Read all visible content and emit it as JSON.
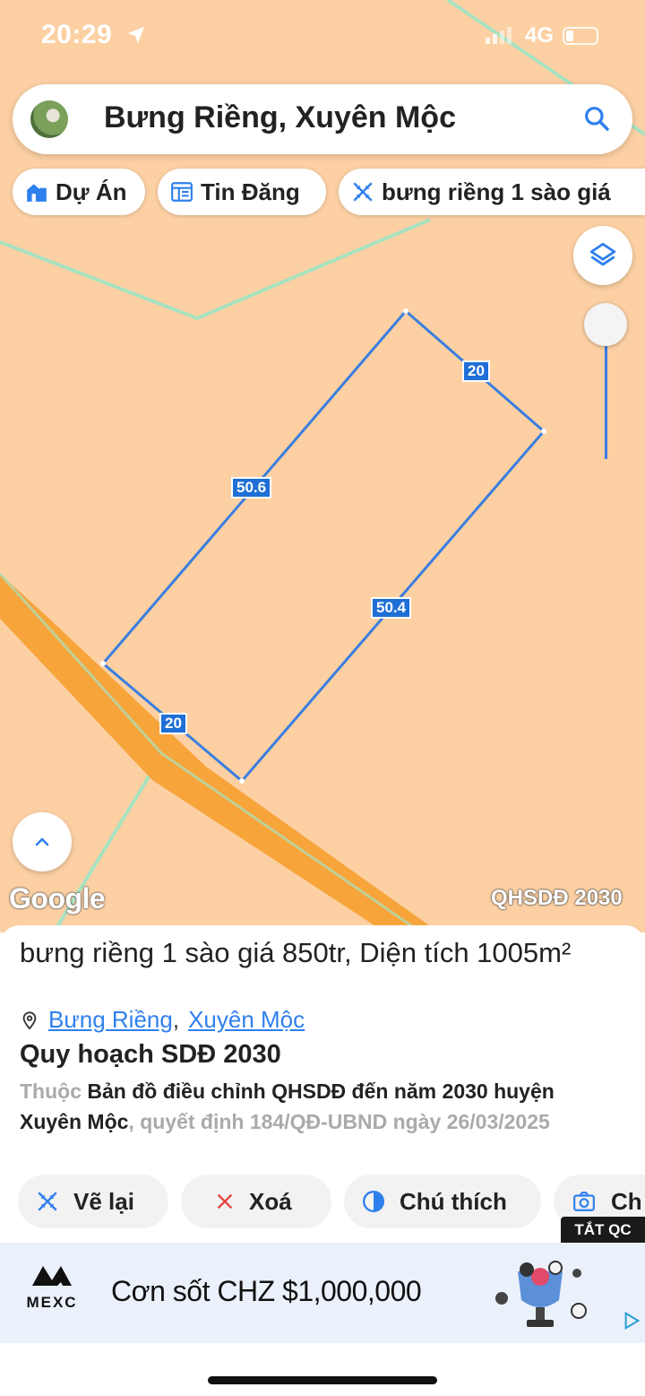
{
  "status_bar": {
    "time": "20:29",
    "network": "4G"
  },
  "search": {
    "query": "Bưng Riềng, Xuyên Mộc"
  },
  "chips": [
    {
      "label": "Dự Án",
      "icon": "building-icon"
    },
    {
      "label": "Tin Đăng",
      "icon": "news-icon"
    },
    {
      "label": "bưng riềng 1 sào giá",
      "icon": "ruler-icon"
    }
  ],
  "map": {
    "dimensions": [
      "20",
      "50.6",
      "50.4",
      "20"
    ],
    "google_label": "Google",
    "layer_label": "QHSDĐ 2030"
  },
  "listing": {
    "title": "bưng riềng 1 sào giá 850tr, Diện tích 1005m²",
    "location": {
      "commune": "Bưng Riềng",
      "separator": ",",
      "district": "Xuyên Mộc"
    },
    "plan_title": "Quy hoạch SDĐ 2030",
    "plan_desc": {
      "prefix": "Thuộc ",
      "map_name": "Bản đồ điều chỉnh QHSDĐ đến năm 2030 huyện Xuyên Mộc",
      "suffix": ", quyết định 184/QĐ-UBND ngày 26/03/2025"
    }
  },
  "actions": [
    {
      "label": "Vẽ lại",
      "icon": "ruler-icon"
    },
    {
      "label": "Xoá",
      "icon": "close-icon"
    },
    {
      "label": "Chú thích",
      "icon": "contrast-icon"
    },
    {
      "label": "Ch",
      "icon": "camera-icon"
    }
  ],
  "ad": {
    "close_label": "TẮT QC",
    "brand": "MEXC",
    "text": "Cơn sốt CHZ $1,000,000"
  },
  "colors": {
    "map_bg": "#fcd0a3",
    "road": "#f7a43a",
    "parcel_line": "#3a7ee0",
    "accent": "#2f80ed"
  }
}
